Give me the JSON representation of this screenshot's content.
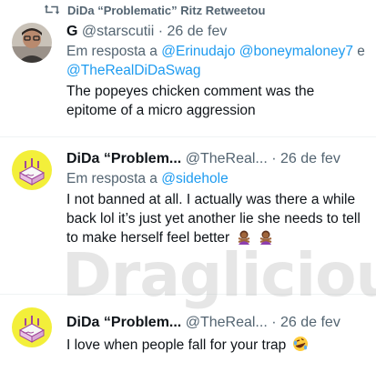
{
  "retweet_bar": {
    "icon": "retweet-icon",
    "text": "DiDa “Problematic” Ritz Retweetou"
  },
  "tweets": [
    {
      "display_name": "G",
      "handle": "@starscutii",
      "separator": "·",
      "date": "26 de fev",
      "reply_prefix": "Em resposta a",
      "reply_mentions": [
        "@Erinudajo",
        "@boneymaloney7",
        "e",
        "@TheRealDiDaSwag"
      ],
      "text": "The popeyes chicken comment was the epitome of a micro aggression"
    },
    {
      "display_name": "DiDa “Problem...",
      "handle": "@TheReal...",
      "separator": "·",
      "date": "26 de fev",
      "reply_prefix": "Em resposta a",
      "reply_mentions": [
        "@sidehole"
      ],
      "text": "I not banned at all. I actually was there a while back lol it’s just yet another lie she needs to tell to make herself feel better",
      "emojis": [
        "woman-gesturing-no-icon",
        "woman-gesturing-no-icon"
      ]
    },
    {
      "display_name": "DiDa “Problem...",
      "handle": "@TheReal...",
      "separator": "·",
      "date": "26 de fev",
      "text": "I love when people fall for your trap",
      "emojis": [
        "rolling-on-floor-laughing-icon"
      ]
    }
  ],
  "watermark": "Draglicious",
  "colors": {
    "text": "#0f1419",
    "secondary": "#536471",
    "link": "#1d9bf0",
    "divider": "#eff3f4",
    "avatar_yellow": "#f3ef3a"
  }
}
